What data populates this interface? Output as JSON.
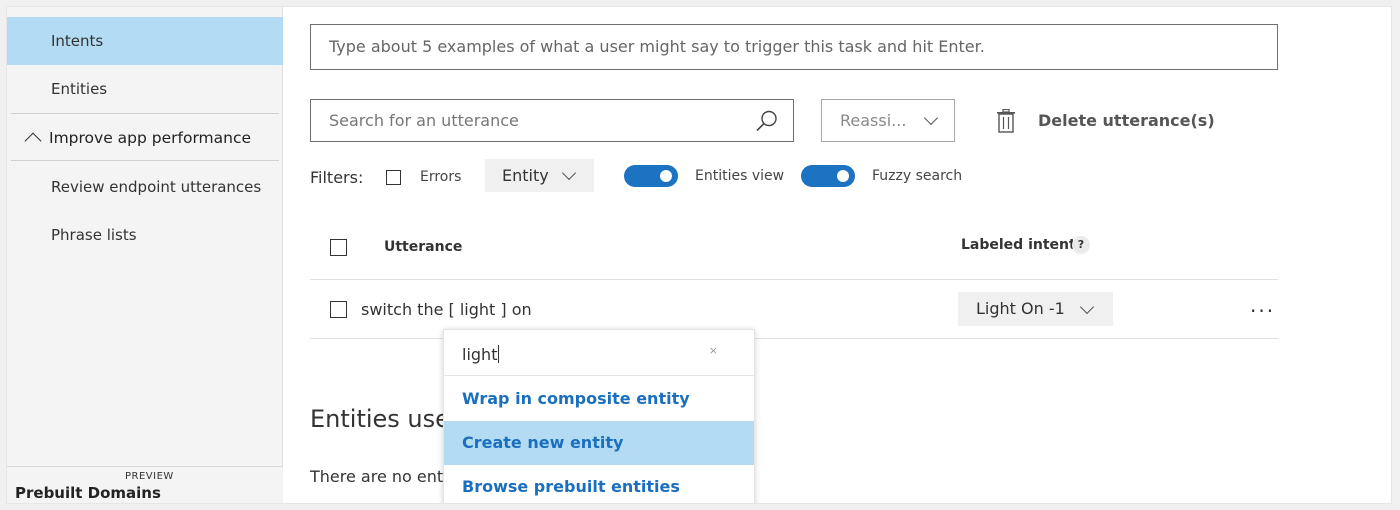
{
  "sidebar": {
    "items": [
      {
        "label": "Intents",
        "active": true
      },
      {
        "label": "Entities"
      },
      {
        "label": "Improve app performance",
        "section": true
      },
      {
        "label": "Review endpoint utterances"
      },
      {
        "label": "Phrase lists"
      }
    ],
    "prebuilt": {
      "preview_tag": "PREVIEW",
      "label": "Prebuilt Domains"
    }
  },
  "main": {
    "example_input_placeholder": "Type about 5 examples of what a user might say to trigger this task and hit Enter.",
    "search_placeholder": "Search for an utterance",
    "reassign_label": "Reassi...",
    "delete_label": "Delete utterance(s)",
    "filters": {
      "label": "Filters:",
      "errors_label": "Errors",
      "entity_dropdown": "Entity",
      "entities_view_label": "Entities view",
      "entities_view_on": true,
      "fuzzy_search_label": "Fuzzy search",
      "fuzzy_search_on": true
    },
    "table": {
      "headers": {
        "utterance": "Utterance",
        "labeled_intent": "Labeled intent",
        "help": "?"
      },
      "rows": [
        {
          "utterance": "switch the [ light ] on",
          "intent": "Light On -1",
          "more": "···"
        }
      ]
    },
    "entities_used_heading": "Entities use",
    "no_entities_text": "There are no entit"
  },
  "popup": {
    "search_value": "light",
    "clear_glyph": "×",
    "items": [
      {
        "label": "Wrap in composite entity"
      },
      {
        "label": "Create new entity",
        "highlighted": true
      },
      {
        "label": "Browse prebuilt entities"
      }
    ]
  },
  "colors": {
    "accent": "#1b73c2",
    "highlight": "#b4dbf4",
    "link": "#1a6fbf"
  }
}
